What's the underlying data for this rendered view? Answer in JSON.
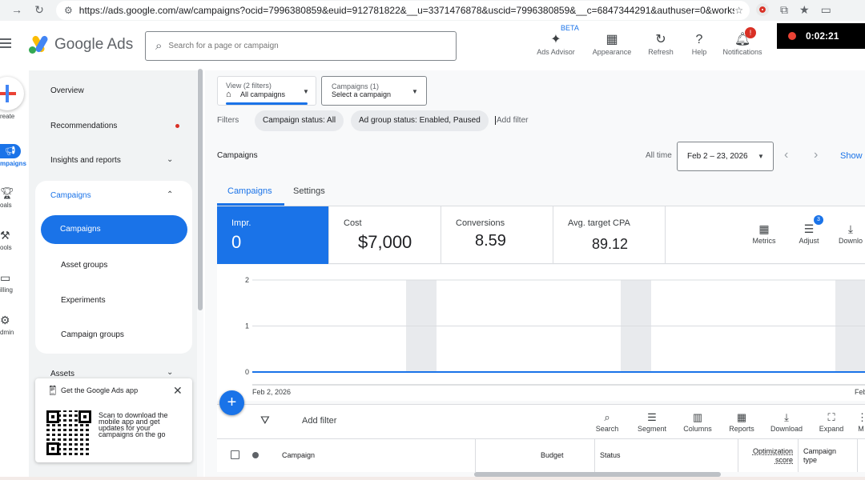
{
  "browser": {
    "url": "https://ads.google.com/aw/campaigns?ocid=7996380859&euid=912781822&__u=3371476878&uscid=7996380859&__c=6847344291&authuser=0&workspaceId=0"
  },
  "header": {
    "logo_text": "Google Ads",
    "search_placeholder": "Search for a page or campaign",
    "beta_label": "BETA",
    "tools": [
      {
        "label": "Ads Advisor",
        "icon": "sparkle-icon"
      },
      {
        "label": "Appearance",
        "icon": "appearance-icon"
      },
      {
        "label": "Refresh",
        "icon": "refresh-icon"
      },
      {
        "label": "Help",
        "icon": "help-icon"
      },
      {
        "label": "Notifications",
        "icon": "bell-icon"
      }
    ],
    "notification_badge": "!",
    "recording_time": "0:02:21"
  },
  "rail": {
    "items": [
      {
        "label": "reate",
        "icon": "plus-icon"
      },
      {
        "label": "mpaigns",
        "icon": "megaphone-icon"
      },
      {
        "label": "oals",
        "icon": "trophy-icon"
      },
      {
        "label": "ools",
        "icon": "tools-icon"
      },
      {
        "label": "illing",
        "icon": "card-icon"
      },
      {
        "label": "dmin",
        "icon": "gear-icon"
      }
    ]
  },
  "sidebar": {
    "overview": "Overview",
    "recommendations": "Recommendations",
    "insights": "Insights and reports",
    "campaigns_group": "Campaigns",
    "campaigns": "Campaigns",
    "asset_groups": "Asset groups",
    "experiments": "Experiments",
    "campaign_groups": "Campaign groups",
    "assets": "Assets"
  },
  "app_promo": {
    "title": "Get the Google Ads app",
    "body": "Scan to download the mobile app and get updates for your campaigns on the go"
  },
  "view_filter": {
    "sub": "View (2 filters)",
    "value": "All campaigns"
  },
  "campaign_select": {
    "sub": "Campaigns (1)",
    "value": "Select a campaign"
  },
  "filters": {
    "label": "Filters",
    "chips": [
      "Campaign status: All",
      "Ad group status: Enabled, Paused"
    ],
    "add_filter": "Add filter"
  },
  "page": {
    "section_title": "Campaigns",
    "all_time": "All time",
    "date_range": "Feb 2 – 23, 2026",
    "show_link": "Show"
  },
  "tabs": [
    "Campaigns",
    "Settings"
  ],
  "scorecards": [
    {
      "label": "Impr.",
      "value": "0"
    },
    {
      "label": "Cost",
      "value": "$7,000"
    },
    {
      "label": "Conversions",
      "value": "8.59"
    },
    {
      "label": "Avg. target CPA",
      "value": "89.12"
    }
  ],
  "chart_tools": [
    {
      "label": "Metrics",
      "icon": "metrics-icon"
    },
    {
      "label": "Adjust",
      "icon": "adjust-icon"
    },
    {
      "label": "Downlo",
      "icon": "download-icon"
    }
  ],
  "adjust_badge": "3",
  "chart_data": {
    "type": "line",
    "y_ticks": [
      "2",
      "1",
      "0"
    ],
    "ylim": [
      0,
      2
    ],
    "x_start_label": "Feb 2, 2026",
    "x_end_label": "Feb",
    "series": [
      {
        "values": [
          0,
          0
        ]
      }
    ],
    "weekend_bands": true
  },
  "table_toolbar": {
    "add_filter": "Add filter",
    "buttons": [
      {
        "label": "Search",
        "icon": "search-icon"
      },
      {
        "label": "Segment",
        "icon": "segment-icon"
      },
      {
        "label": "Columns",
        "icon": "columns-icon"
      },
      {
        "label": "Reports",
        "icon": "reports-icon"
      },
      {
        "label": "Download",
        "icon": "download-icon"
      },
      {
        "label": "Expand",
        "icon": "expand-icon"
      },
      {
        "label": "M",
        "icon": "more-icon"
      }
    ]
  },
  "table": {
    "columns": [
      "Campaign",
      "Budget",
      "Status",
      "Optimization score",
      "Campaign type"
    ]
  }
}
